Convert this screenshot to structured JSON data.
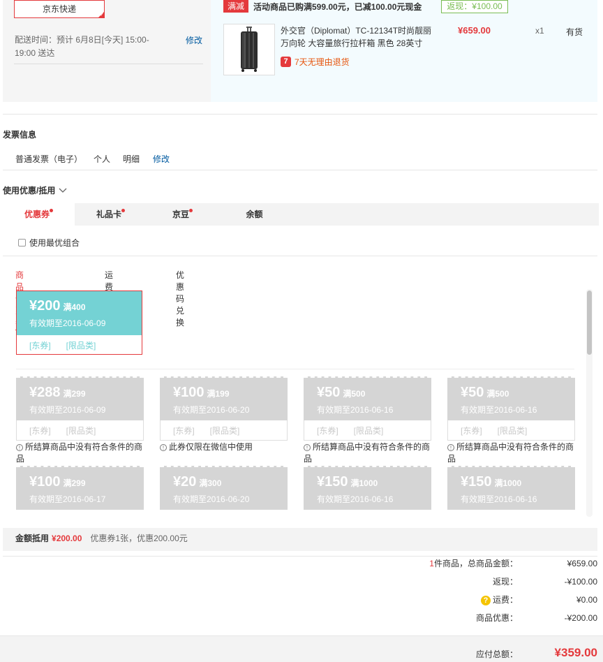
{
  "shipping": {
    "method": "京东快递",
    "time_text": "配送时间：预计 6月8日[今天] 15:00-19:00 送达",
    "edit": "修改"
  },
  "goods": {
    "promo_tag": "满减",
    "promo_text": "活动商品已购满599.00元，已减100.00元现金",
    "cashback": "返现：¥100.00",
    "product_name": "外交官（Diplomat）TC-12134T时尚靓丽万向轮 大容量旅行拉杆箱 黑色 28英寸",
    "return_icon": "7",
    "return_policy": "7天无理由退货",
    "price": "¥659.00",
    "quantity": "x1",
    "stock": "有货",
    "product_icon": "suitcase-image"
  },
  "invoice": {
    "title": "发票信息",
    "type": "普通发票（电子）",
    "holder": "个人",
    "content": "明细",
    "edit": "修改"
  },
  "coupons": {
    "title": "使用优惠/抵用",
    "tabs": [
      {
        "label": "优惠券",
        "dot": true
      },
      {
        "label": "礼品卡",
        "dot": true
      },
      {
        "label": "京豆",
        "dot": true
      },
      {
        "label": "余额",
        "dot": false
      }
    ],
    "optimal_label": "使用最优组合",
    "subtabs": [
      "商品优惠券",
      "运费券",
      "优惠码兑换"
    ],
    "active_coupon": {
      "amount": "¥200",
      "condition": "满400",
      "expiry": "有效期至2016-06-09",
      "type1": "[东券]",
      "type2": "[限品类]"
    },
    "unavailable": [
      {
        "amount": "¥288",
        "condition": "满299",
        "expiry": "有效期至2016-06-09",
        "type1": "[东券]",
        "type2": "[限品类]",
        "note": "所结算商品中没有符合条件的商品"
      },
      {
        "amount": "¥100",
        "condition": "满199",
        "expiry": "有效期至2016-06-20",
        "type1": "[东券]",
        "type2": "[限品类]",
        "note": "此券仅限在微信中使用"
      },
      {
        "amount": "¥50",
        "condition": "满500",
        "expiry": "有效期至2016-06-16",
        "type1": "[东券]",
        "type2": "[限品类]",
        "note": "所结算商品中没有符合条件的商品"
      },
      {
        "amount": "¥50",
        "condition": "满500",
        "expiry": "有效期至2016-06-16",
        "type1": "[东券]",
        "type2": "[限品类]",
        "note": "所结算商品中没有符合条件的商品"
      },
      {
        "amount": "¥100",
        "condition": "满299",
        "expiry": "有效期至2016-06-17"
      },
      {
        "amount": "¥20",
        "condition": "满300",
        "expiry": "有效期至2016-06-20"
      },
      {
        "amount": "¥150",
        "condition": "满1000",
        "expiry": "有效期至2016-06-16"
      },
      {
        "amount": "¥150",
        "condition": "满1000",
        "expiry": "有效期至2016-06-16"
      }
    ],
    "discount_label": "金额抵用",
    "discount_amount": "¥200.00",
    "discount_detail": "优惠券1张，优惠200.00元"
  },
  "summary": {
    "count": "1",
    "count_label": "件商品，总商品金额：",
    "goods_total": "¥659.00",
    "cashback_label": "返现：",
    "cashback": "-¥100.00",
    "shipping_label": "运费：",
    "shipping": "¥0.00",
    "discount_label": "商品优惠：",
    "discount": "-¥200.00",
    "payable_label": "应付总额：",
    "payable": "¥359.00"
  },
  "colors": {
    "accent": "#e4393c",
    "coupon_active": "#74d2d4",
    "link": "#005aa0"
  }
}
